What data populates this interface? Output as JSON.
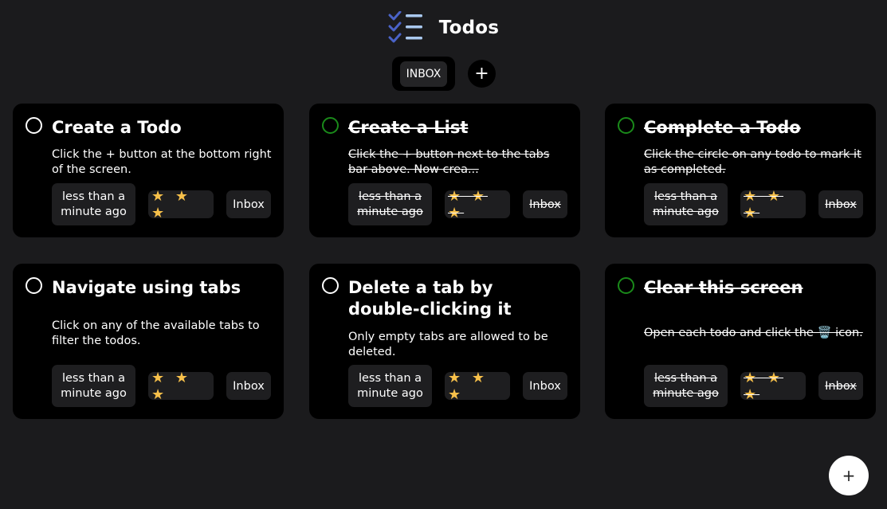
{
  "app": {
    "title": "Todos",
    "logo_icon": "checklist-icon"
  },
  "tabs": [
    {
      "label": "INBOX",
      "selected": true
    }
  ],
  "add_tab_label": "+",
  "fab_label": "+",
  "colors": {
    "accent_done": "#1a8a1a",
    "star": "#f7c04a",
    "card_bg": "#000000",
    "page_bg": "#1b1b1d"
  },
  "todos": [
    {
      "title": "Create a Todo",
      "description": "Click the + button at the bottom right of the screen.",
      "time": "less than a minute ago",
      "stars": "★ ★ ★",
      "rating": 3,
      "tag": "Inbox",
      "completed": false
    },
    {
      "title": "Create a List",
      "description": "Click the + button next to the tabs bar above. Now crea...",
      "time": "less than a minute ago",
      "stars": "★ ★ ★",
      "rating": 3,
      "tag": "Inbox",
      "completed": true
    },
    {
      "title": "Complete a Todo",
      "description": "Click the circle on any todo to mark it as completed.",
      "time": "less than a minute ago",
      "stars": "★ ★ ★",
      "rating": 3,
      "tag": "Inbox",
      "completed": true
    },
    {
      "title": "Navigate using tabs",
      "description": "Click on any of the available tabs to filter the todos.",
      "time": "less than a minute ago",
      "stars": "★ ★ ★",
      "rating": 3,
      "tag": "Inbox",
      "completed": false
    },
    {
      "title": "Delete a tab by double-clicking it",
      "description": "Only empty tabs are allowed to be deleted.",
      "time": "less than a minute ago",
      "stars": "★ ★ ★",
      "rating": 3,
      "tag": "Inbox",
      "completed": false
    },
    {
      "title": "Clear this screen",
      "description": "Open each todo and click the 🗑️ icon.",
      "time": "less than a minute ago",
      "stars": "★ ★ ★",
      "rating": 3,
      "tag": "Inbox",
      "completed": true
    }
  ]
}
